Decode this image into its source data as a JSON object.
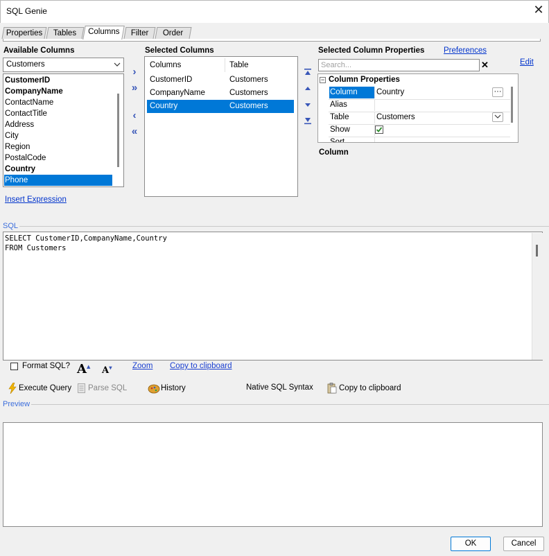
{
  "window": {
    "title": "SQL Genie",
    "close_glyph": "✕"
  },
  "tabs": [
    {
      "label": "Properties"
    },
    {
      "label": "Tables"
    },
    {
      "label": "Columns"
    },
    {
      "label": "Filter"
    },
    {
      "label": "Order"
    }
  ],
  "active_tab": "Columns",
  "available": {
    "heading": "Available Columns",
    "table_select": "Customers",
    "items": [
      {
        "label": "CustomerID",
        "bold": true
      },
      {
        "label": "CompanyName",
        "bold": true
      },
      {
        "label": "ContactName",
        "bold": false
      },
      {
        "label": "ContactTitle",
        "bold": false
      },
      {
        "label": "Address",
        "bold": false
      },
      {
        "label": "City",
        "bold": false
      },
      {
        "label": "Region",
        "bold": false
      },
      {
        "label": "PostalCode",
        "bold": false
      },
      {
        "label": "Country",
        "bold": true
      },
      {
        "label": "Phone",
        "bold": false,
        "selected": true
      }
    ],
    "insert_expression": "Insert Expression"
  },
  "selected": {
    "heading": "Selected Columns",
    "headers": [
      "Columns",
      "Table"
    ],
    "rows": [
      {
        "column": "CustomerID",
        "table": "Customers"
      },
      {
        "column": "CompanyName",
        "table": "Customers"
      },
      {
        "column": "Country",
        "table": "Customers",
        "selected": true
      }
    ]
  },
  "column_props": {
    "heading": "Selected Column Properties",
    "preferences": "Preferences",
    "edit": "Edit",
    "search_placeholder": "Search...",
    "clear_glyph": "✕",
    "category": "Column Properties",
    "rows": [
      {
        "name": "Column",
        "value": "Country"
      },
      {
        "name": "Alias",
        "value": ""
      },
      {
        "name": "Table",
        "value": "Customers"
      },
      {
        "name": "Show",
        "value": ""
      },
      {
        "name": "Sort",
        "value": ""
      }
    ],
    "description_title": "Column"
  },
  "sql": {
    "group_label": "SQL",
    "text": "SELECT CustomerID,CompanyName,Country\nFROM Customers",
    "format_sql": "Format SQL?",
    "font_up": "A",
    "font_down": "A",
    "zoom": "Zoom",
    "copy": "Copy to clipboard"
  },
  "toolbar": {
    "execute": "Execute Query",
    "parse": "Parse SQL",
    "history": "History",
    "native": "Native SQL Syntax",
    "copy": "Copy to clipboard"
  },
  "preview": {
    "group_label": "Preview"
  },
  "buttons": {
    "ok": "OK",
    "cancel": "Cancel"
  },
  "colors": {
    "selection": "#0078d7",
    "link": "#0033cc",
    "group_label": "#3c6edc"
  }
}
